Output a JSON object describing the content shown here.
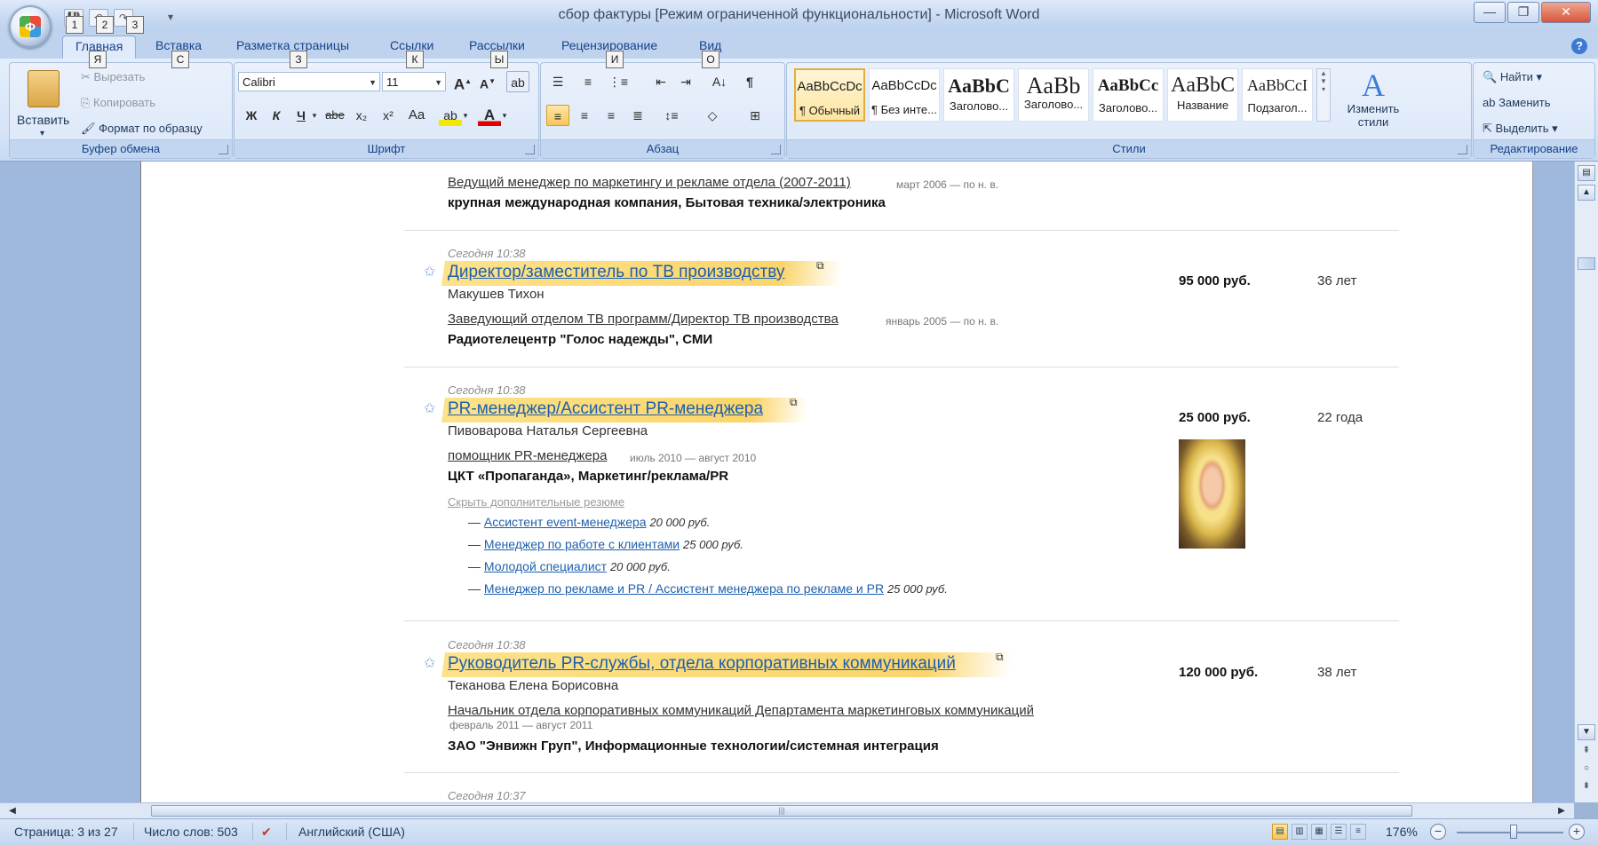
{
  "window": {
    "title": "сбор фактуры [Режим ограниченной функциональности] - Microsoft Word",
    "minimize": "—",
    "maximize": "❐",
    "close": "✕"
  },
  "office_logo": "Ф",
  "qat": {
    "save": "1",
    "undo": "2",
    "redo": "3"
  },
  "keytips": [
    "1",
    "2",
    "3",
    "Я",
    "С",
    "З",
    "К",
    "Ы",
    "И",
    "О"
  ],
  "tabs": [
    {
      "label": "Главная"
    },
    {
      "label": "Вставка"
    },
    {
      "label": "Разметка страницы"
    },
    {
      "label": "Ссылки"
    },
    {
      "label": "Рассылки"
    },
    {
      "label": "Рецензирование"
    },
    {
      "label": "Вид"
    }
  ],
  "clipboard": {
    "paste": "Вставить",
    "cut": "Вырезать",
    "copy": "Копировать",
    "format_painter": "Формат по образцу",
    "label": "Буфер обмена"
  },
  "font": {
    "name": "Calibri",
    "size": "11",
    "bold": "Ж",
    "italic": "К",
    "underline": "Ч",
    "strike": "abe",
    "subscript": "x₂",
    "superscript": "x²",
    "case": "Aa",
    "label": "Шрифт"
  },
  "paragraph": {
    "label": "Абзац"
  },
  "styles": {
    "label": "Стили",
    "tiles": [
      {
        "sample": "AaBbCcDc",
        "name": "¶ Обычный"
      },
      {
        "sample": "AaBbCcDc",
        "name": "¶ Без инте..."
      },
      {
        "sample": "AaBbC",
        "name": "Заголово..."
      },
      {
        "sample": "AaBb",
        "name": "Заголово..."
      },
      {
        "sample": "AaBbCc",
        "name": "Заголово..."
      },
      {
        "sample": "AaBbC",
        "name": "Название"
      },
      {
        "sample": "AaBbCcI",
        "name": "Подзагол..."
      }
    ],
    "change": "Изменить стили"
  },
  "editing": {
    "find": "Найти",
    "replace": "Заменить",
    "select": "Выделить",
    "label": "Редактирование"
  },
  "document": {
    "top_block": {
      "position": "Ведущий менеджер по маркетингу и рекламе отдела (2007-2011)",
      "dates": "март 2006 — по н. в.",
      "company": "крупная международная компания, Бытовая техника/электроника"
    },
    "resumes": [
      {
        "time": "Сегодня 10:38",
        "title": "Директор/заместитель по ТВ производству",
        "name": "Макушев Тихон",
        "position": "Заведующий отделом ТВ программ/Директор ТВ производства",
        "dates": "январь 2005 — по н. в.",
        "company": "Радиотелецентр \"Голос надежды\", СМИ",
        "salary": "95 000 руб.",
        "age": "36 лет"
      },
      {
        "time": "Сегодня 10:38",
        "title": "PR-менеджер/Ассистент PR-менеджера",
        "name": "Пивоварова Наталья Сергеевна",
        "position": "помощник PR-менеджера",
        "dates": "июль 2010 — август 2010",
        "company": "ЦКТ «Пропаганда», Маркетинг/реклама/PR",
        "salary": "25 000 руб.",
        "age": "22 года",
        "hide_link": "Скрыть дополнительные резюме",
        "alternatives": [
          {
            "title": "Ассистент event-менеджера",
            "salary": "20 000 руб."
          },
          {
            "title": "Менеджер по работе с клиентами",
            "salary": "25 000 руб."
          },
          {
            "title": "Молодой специалист",
            "salary": "20 000 руб."
          },
          {
            "title": "Менеджер по рекламе и PR / Ассистент менеджера по рекламе и PR",
            "salary": "25 000 руб."
          }
        ]
      },
      {
        "time": "Сегодня 10:38",
        "title": "Руководитель PR-службы, отдела корпоративных коммуникаций",
        "name": "Теканова Елена Борисовна",
        "position": "Начальник отдела корпоративных коммуникаций Департамента маркетинговых коммуникаций",
        "dates": "февраль 2011 — август 2011",
        "company": "ЗАО \"Энвижн Груп\", Информационные технологии/системная интеграция",
        "salary": "120 000 руб.",
        "age": "38 лет"
      },
      {
        "time": "Сегодня 10:37"
      }
    ]
  },
  "status": {
    "page": "Страница: 3 из 27",
    "words": "Число слов: 503",
    "language": "Английский (США)",
    "zoom": "176%"
  }
}
